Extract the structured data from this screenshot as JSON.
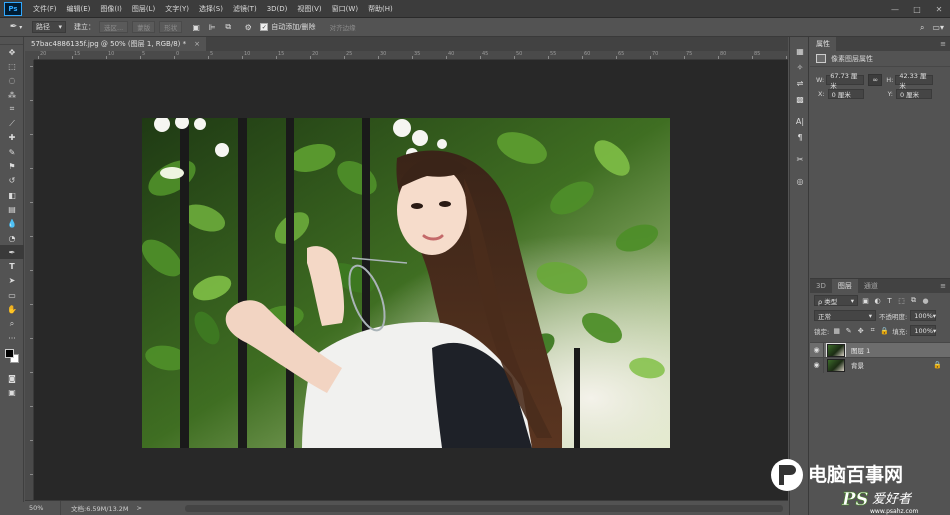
{
  "menubar": {
    "logo": "Ps",
    "items": [
      "文件(F)",
      "编辑(E)",
      "图像(I)",
      "图层(L)",
      "文字(Y)",
      "选择(S)",
      "滤镜(T)",
      "3D(D)",
      "视图(V)",
      "窗口(W)",
      "帮助(H)"
    ],
    "window_controls": [
      "—",
      "□",
      "✕"
    ]
  },
  "options": {
    "tool_icon": "pen-icon",
    "mode_select": "路径",
    "make_label": "建立：",
    "selection_btn": "选区...",
    "mask_btn": "蒙版",
    "shape_btn": "形状",
    "auto_add_delete_label": "自动添加/删除",
    "auto_add_delete_checked": true,
    "align_edges_btn": "对齐边缘"
  },
  "document": {
    "tab_title": "57bac4886135f.jpg @ 50% (图层 1, RGB/8) *",
    "close_label": "×",
    "ruler_top_labels": [
      "20",
      "15",
      "10",
      "5",
      "0",
      "5",
      "10",
      "15",
      "20",
      "25",
      "30",
      "35",
      "40",
      "45",
      "50",
      "55",
      "60",
      "65",
      "70",
      "75",
      "80",
      "85",
      "90"
    ]
  },
  "status": {
    "zoom": "50%",
    "doc_info": "文档:6.59M/13.2M",
    "arrow": ">"
  },
  "properties": {
    "tab_label": "属性",
    "subheader": "像素图层属性",
    "w_label": "W:",
    "w_value": "67.73 厘米",
    "h_label": "H:",
    "h_value": "42.33 厘米",
    "x_label": "X:",
    "x_value": "0 厘米",
    "y_label": "Y:",
    "y_value": "0 厘米",
    "link_icon": "∞"
  },
  "layers": {
    "tabs": [
      "3D",
      "图层",
      "通道"
    ],
    "active_tab": "图层",
    "filter_label": "ρ 类型",
    "blend_mode": "正常",
    "opacity_label": "不透明度:",
    "opacity_value": "100%",
    "lock_label": "锁定:",
    "fill_label": "填充:",
    "fill_value": "100%",
    "rows": [
      {
        "name": "图层 1",
        "selected": true,
        "locked": false
      },
      {
        "name": "背景",
        "selected": false,
        "locked": true
      }
    ]
  },
  "watermark": {
    "brand": "电脑百事网",
    "ps_text": "PS",
    "script_text": "爱好者",
    "url": "www.psahz.com"
  }
}
